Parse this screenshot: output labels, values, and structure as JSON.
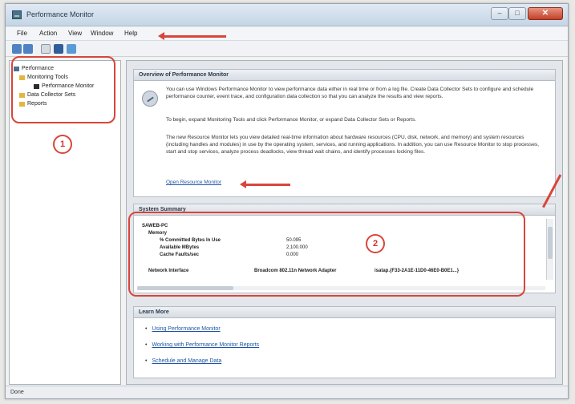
{
  "window": {
    "title": "Performance Monitor"
  },
  "menu": [
    "File",
    "Action",
    "View",
    "Window",
    "Help"
  ],
  "tree": {
    "root": "Performance",
    "monitoring_tools": "Monitoring Tools",
    "performance_monitor": "Performance Monitor",
    "data_collector_sets": "Data Collector Sets",
    "reports": "Reports"
  },
  "overview": {
    "header": "Overview of Performance Monitor",
    "p1": "You can use Windows Performance Monitor to view performance data either in real time or from a log file. Create Data Collector Sets to configure and schedule performance counter, event trace, and configuration data collection so that you can analyze the results and view reports.",
    "p2": "To begin, expand Monitoring Tools and click Performance Monitor, or expand Data Collector Sets or Reports.",
    "p3": "The new Resource Monitor lets you view detailed real-time information about hardware resources (CPU, disk, network, and memory) and system resources (including handles and modules) in use by the operating system, services, and running applications. In addition, you can use Resource Monitor to stop processes, start and stop services, analyze process deadlocks, view thread wait chains, and identify processes locking files.",
    "link": "Open Resource Monitor"
  },
  "summary": {
    "header": "System Summary",
    "host": "SAWEB-PC",
    "memory_label": "Memory",
    "rows": [
      {
        "label": "% Committed Bytes In Use",
        "value": "50.095"
      },
      {
        "label": "Available MBytes",
        "value": "2,100.000"
      },
      {
        "label": "Cache Faults/sec",
        "value": "0.000"
      }
    ],
    "network_label": "Network Interface",
    "network_col1": "Broadcom 802.11n Network Adapter",
    "network_col2": "isatap.{F33-2A1E-11D0-46E0-B0E1...}"
  },
  "links": {
    "header": "Learn More",
    "items": [
      "Using Performance Monitor",
      "Working with Performance Monitor Reports",
      "Schedule and Manage Data"
    ]
  },
  "status": "Done",
  "annotations": {
    "one": "1",
    "two": "2"
  },
  "colors": {
    "annotation": "#d9453a",
    "link": "#1f55a5"
  }
}
